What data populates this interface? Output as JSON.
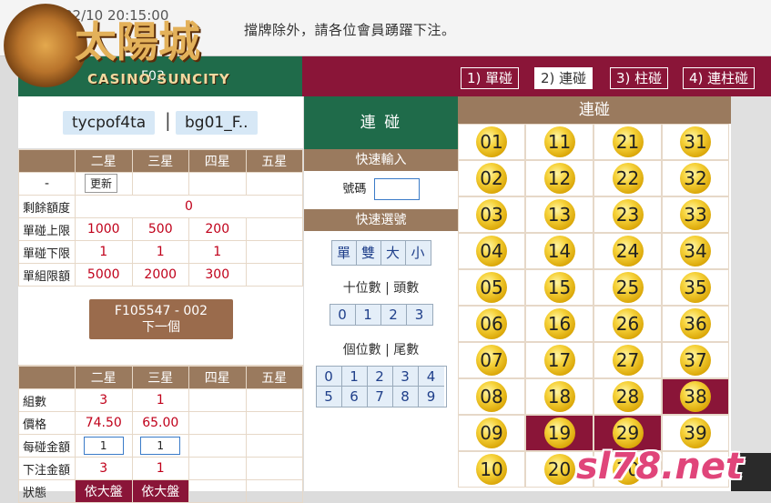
{
  "header": {
    "timestamp": "02/10 20:15:00",
    "marquee": "擋牌除外，請各位會員踴躍下注。",
    "logo_cn": "太陽城",
    "logo_en": "CASINO SUNCITY",
    "green_title": "F03"
  },
  "tabs": [
    {
      "label": "1) 單碰",
      "active": false
    },
    {
      "label": "2) 連碰",
      "active": true
    },
    {
      "label": "3) 柱碰",
      "active": false
    },
    {
      "label": "4) 連柱碰",
      "active": false
    }
  ],
  "user": {
    "account": "tycpof4ta",
    "separator": "|",
    "game": "bg01_F.."
  },
  "limits": {
    "headers": [
      "",
      "二星",
      "三星",
      "四星",
      "五星"
    ],
    "dash": "-",
    "update_label": "更新",
    "rows": [
      {
        "label": "剩餘額度",
        "values": [
          "0"
        ]
      },
      {
        "label": "單碰上限",
        "values": [
          "1000",
          "500",
          "200",
          ""
        ]
      },
      {
        "label": "單碰下限",
        "values": [
          "1",
          "1",
          "1",
          ""
        ]
      },
      {
        "label": "單組限額",
        "values": [
          "5000",
          "2000",
          "300",
          ""
        ]
      }
    ]
  },
  "next_button": {
    "line1": "F105547 - 002",
    "line2": "下一個"
  },
  "bet": {
    "headers": [
      "",
      "二星",
      "三星",
      "四星",
      "五星"
    ],
    "rows": [
      {
        "label": "組數",
        "values": [
          "3",
          "1",
          "",
          ""
        ]
      },
      {
        "label": "價格",
        "values": [
          "74.50",
          "65.00",
          "",
          ""
        ]
      },
      {
        "label": "每碰金額",
        "values": [
          "1",
          "1",
          "",
          ""
        ]
      },
      {
        "label": "下注金額",
        "values": [
          "3",
          "1",
          "",
          ""
        ]
      },
      {
        "label": "狀態",
        "values": [
          "依大盤",
          "依大盤",
          "",
          ""
        ]
      }
    ]
  },
  "middle": {
    "title": "連 碰",
    "quick_input": "快速輸入",
    "number_label": "號碼",
    "quick_select": "快速選號",
    "parity_buttons": [
      "單",
      "雙",
      "大",
      "小"
    ],
    "tens_caption": "十位數 | 頭數",
    "tens_buttons": [
      "0",
      "1",
      "2",
      "3"
    ],
    "units_caption": "個位數 | 尾數",
    "units_buttons_row1": [
      "0",
      "1",
      "2",
      "3",
      "4"
    ],
    "units_buttons_row2": [
      "5",
      "6",
      "7",
      "8",
      "9"
    ]
  },
  "numbers": {
    "title": "連碰",
    "balls": [
      {
        "n": "01",
        "sel": false
      },
      {
        "n": "11",
        "sel": false
      },
      {
        "n": "21",
        "sel": false
      },
      {
        "n": "31",
        "sel": false
      },
      {
        "n": "02",
        "sel": false
      },
      {
        "n": "12",
        "sel": false
      },
      {
        "n": "22",
        "sel": false
      },
      {
        "n": "32",
        "sel": false
      },
      {
        "n": "03",
        "sel": false
      },
      {
        "n": "13",
        "sel": false
      },
      {
        "n": "23",
        "sel": false
      },
      {
        "n": "33",
        "sel": false
      },
      {
        "n": "04",
        "sel": false
      },
      {
        "n": "14",
        "sel": false
      },
      {
        "n": "24",
        "sel": false
      },
      {
        "n": "34",
        "sel": false
      },
      {
        "n": "05",
        "sel": false
      },
      {
        "n": "15",
        "sel": false
      },
      {
        "n": "25",
        "sel": false
      },
      {
        "n": "35",
        "sel": false
      },
      {
        "n": "06",
        "sel": false
      },
      {
        "n": "16",
        "sel": false
      },
      {
        "n": "26",
        "sel": false
      },
      {
        "n": "36",
        "sel": false
      },
      {
        "n": "07",
        "sel": false
      },
      {
        "n": "17",
        "sel": false
      },
      {
        "n": "27",
        "sel": false
      },
      {
        "n": "37",
        "sel": false
      },
      {
        "n": "08",
        "sel": false
      },
      {
        "n": "18",
        "sel": false
      },
      {
        "n": "28",
        "sel": false
      },
      {
        "n": "38",
        "sel": true
      },
      {
        "n": "09",
        "sel": false
      },
      {
        "n": "19",
        "sel": true
      },
      {
        "n": "29",
        "sel": true
      },
      {
        "n": "39",
        "sel": false
      },
      {
        "n": "10",
        "sel": false
      },
      {
        "n": "20",
        "sel": false
      },
      {
        "n": "30",
        "sel": false
      },
      {
        "n": "",
        "sel": false
      }
    ]
  },
  "watermark": "sl78.net",
  "colors": {
    "green": "#1f6b4a",
    "maroon": "#8a1538",
    "brown": "#9a7a5e",
    "ball": "#f6d23a"
  }
}
